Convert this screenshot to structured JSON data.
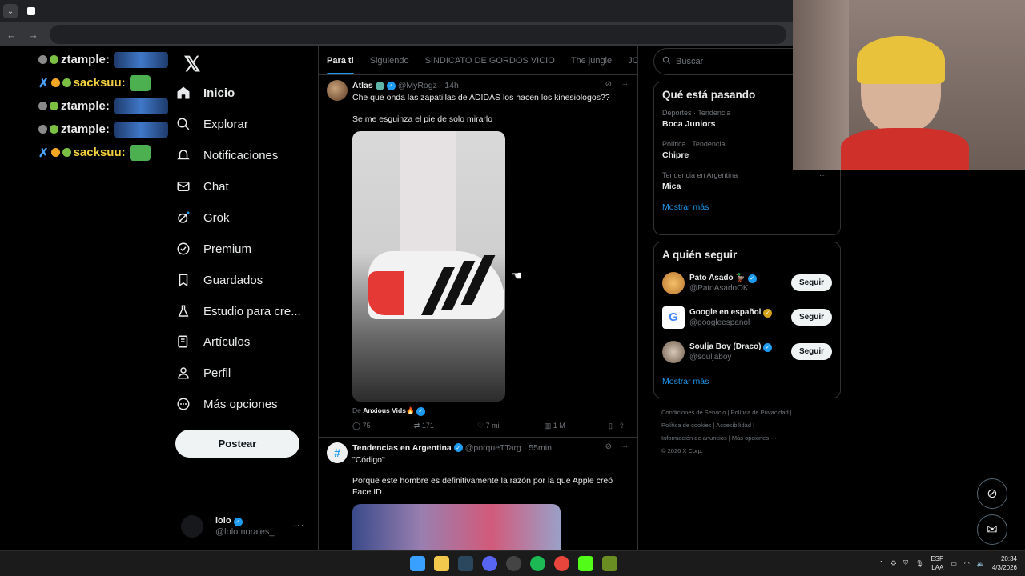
{
  "browser": {
    "tab_icon": "x-icon",
    "dropdown": "⌄"
  },
  "chat": [
    {
      "nick": "ztample:",
      "kind": "z"
    },
    {
      "nick": "sacksuu:",
      "kind": "s"
    },
    {
      "nick": "sacksuu:",
      "kind": "s"
    },
    {
      "nick": "ztample:",
      "kind": "z"
    },
    {
      "nick": "ztample:",
      "kind": "z"
    },
    {
      "nick": "sacksuu:",
      "kind": "s"
    }
  ],
  "nav": {
    "items": [
      {
        "label": "Inicio",
        "icon": "home-icon"
      },
      {
        "label": "Explorar",
        "icon": "search-icon"
      },
      {
        "label": "Notificaciones",
        "icon": "bell-icon"
      },
      {
        "label": "Chat",
        "icon": "mail-icon"
      },
      {
        "label": "Grok",
        "icon": "grok-icon"
      },
      {
        "label": "Premium",
        "icon": "premium-icon"
      },
      {
        "label": "Guardados",
        "icon": "bookmark-icon"
      },
      {
        "label": "Estudio para cre...",
        "icon": "flask-icon"
      },
      {
        "label": "Artículos",
        "icon": "article-icon"
      },
      {
        "label": "Perfil",
        "icon": "person-icon"
      },
      {
        "label": "Más opciones",
        "icon": "more-circle-icon"
      }
    ],
    "post_button": "Postear",
    "user_name": "lolo",
    "user_handle": "@lolomorales_"
  },
  "tabs": [
    "Para ti",
    "Siguiendo",
    "SINDICATO DE GORDOS VICIO",
    "The jungle",
    "JOSEO"
  ],
  "posts": [
    {
      "name": "Atlas",
      "handle": "@MyRogz",
      "time": "· 14h",
      "text1": "Che que onda las zapatillas de ADIDAS los hacen los kinesiologos??",
      "text2": "Se me esguinza el pie de solo mirarlo",
      "source_prefix": "De",
      "source": "Anxious Vids🔥",
      "replies": "75",
      "reposts": "171",
      "likes": "7 mil",
      "views": "1 M"
    },
    {
      "name": "Tendencias en Argentina",
      "handle": "@porqueTTarg",
      "time": "· 55min",
      "text1": "\"Código\"",
      "text2": "Porque este hombre es definitivamente la razón por la que Apple creó Face ID."
    }
  ],
  "search_placeholder": "Buscar",
  "trending": {
    "title": "Qué está pasando",
    "items": [
      {
        "context": "Deportes · Tendencia",
        "name": "Boca Juniors"
      },
      {
        "context": "Política · Tendencia",
        "name": "Chipre"
      },
      {
        "context": "Tendencia en Argentina",
        "name": "Mica"
      }
    ],
    "more": "Mostrar más"
  },
  "who_to_follow": {
    "title": "A quién seguir",
    "items": [
      {
        "name": "Pato Asado 🦆",
        "handle": "@PatoAsadoOK",
        "button": "Seguir"
      },
      {
        "name": "Google en español",
        "handle": "@googleespanol",
        "button": "Seguir"
      },
      {
        "name": "Soulja Boy (Draco)",
        "handle": "@souljaboy",
        "button": "Seguir"
      }
    ],
    "more": "Mostrar más"
  },
  "footer": {
    "line1": "Condiciones de Servicio  |  Política de Privacidad  |",
    "line2": "Política de cookies  |  Accesibilidad  |",
    "line3": "Información de anuncios  |  Más opciones ···",
    "line4": "© 2026 X Corp."
  },
  "tray": {
    "lang1": "ESP",
    "lang2": "LAA",
    "time": "20:34",
    "date": "4/3/2026"
  },
  "colors": {
    "accent": "#1d9bf0",
    "bg": "#000000",
    "border": "#2f3336"
  }
}
